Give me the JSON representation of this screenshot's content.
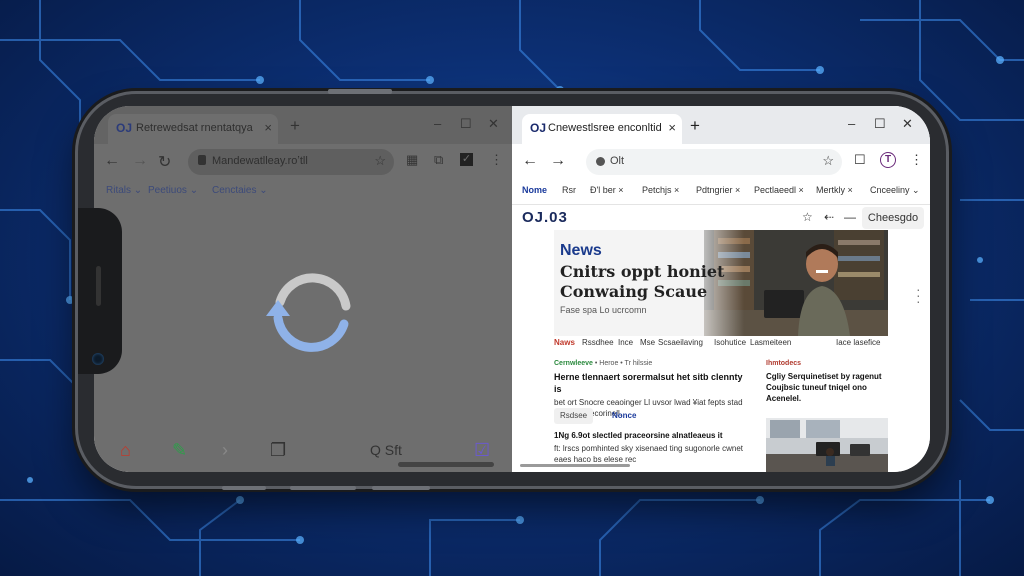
{
  "left": {
    "tab": {
      "favicon": "OJ",
      "title": "Retrewedsat rnentatqya",
      "close": "×",
      "new": "+"
    },
    "window_controls": [
      "–",
      "☐",
      "✕"
    ],
    "nav": {
      "back": "←",
      "forward": "→",
      "reload": "↻"
    },
    "omnibox": {
      "url": "Mandewatlleay.roʼtll"
    },
    "bookmarks": [
      "Ritals ⌄",
      "Peetiuos ⌄",
      "Cenctaies ⌄"
    ],
    "loading": true,
    "bottom_icons": [
      "home-icon",
      "bookmark-add-icon",
      "chevron-right-icon",
      "tabs-icon",
      "search-icon",
      "checked-shield-icon"
    ],
    "bottom_label": "Q Sft"
  },
  "right": {
    "tab": {
      "favicon": "OJ",
      "title": "Cnewestlsree enconltid",
      "close": "×",
      "new": "+"
    },
    "window_controls": [
      "–",
      "☐",
      "✕"
    ],
    "nav": {
      "back": "←",
      "forward": "→"
    },
    "omnibox": {
      "url": "Olt"
    },
    "toolbar_extra": [
      "☐",
      "T",
      "⋮"
    ],
    "bookmarks": [
      {
        "label": "Nome",
        "active": true
      },
      {
        "label": "Rsr",
        "active": false
      },
      {
        "label": "Ð'l ber ×",
        "active": false
      },
      {
        "label": "Petchjs ×",
        "active": false
      },
      {
        "label": "Pdtngrier ×",
        "active": false
      },
      {
        "label": "Pectlaeedl ×",
        "active": false
      },
      {
        "label": "Mertkly ×",
        "active": false
      },
      {
        "label": "Cnceeliny ⌄",
        "active": false
      }
    ],
    "site": {
      "logo": "OJ.03",
      "tools": [
        "☆",
        "⇠",
        "—"
      ],
      "button": "Cheesgdo",
      "hero": {
        "label": "News",
        "headline_1": "Cnitrs oppt honiet",
        "headline_2": "Conwaing Scaue",
        "byline": "Fase spa Lo ucrcomn"
      },
      "categories": [
        {
          "text": "Naws",
          "red": true
        },
        {
          "text": "Rssdhee",
          "red": false
        },
        {
          "text": "Ince",
          "red": false
        },
        {
          "text": "Mse",
          "red": false
        },
        {
          "text": "Scsaeilaving",
          "red": false
        },
        {
          "text": "Isohutice",
          "red": false
        },
        {
          "text": "Lasmeiteen",
          "red": false
        },
        {
          "text": "Iace lasefice",
          "red": false
        }
      ],
      "article": {
        "kicker": "Cernwleeve",
        "kicker_meta": "• Heroe • Tr hilssie",
        "headline": "Herne tlennaert sorermalsut het sitb clennty is",
        "body": "bet ort Snocre ceaoinger Ll uvsor lwad ¥iat fepts stad hcantiosit ecorinell."
      },
      "chips": [
        "Rsdsee",
        "Nonce"
      ],
      "article2": {
        "headline": "1Ng 6.9ot slectled praceorsine alnatleaeus it",
        "body": "ft: lrscs pomhinted sky xisenaed ting sugonorle cwnet eaes haco bs elese rec"
      },
      "side": {
        "kicker": "Ihmtodecs",
        "headline": "Cgliy Serquinetiset by ragenut Coujbsic tuneuf tniqel ono Acenelel."
      }
    }
  }
}
